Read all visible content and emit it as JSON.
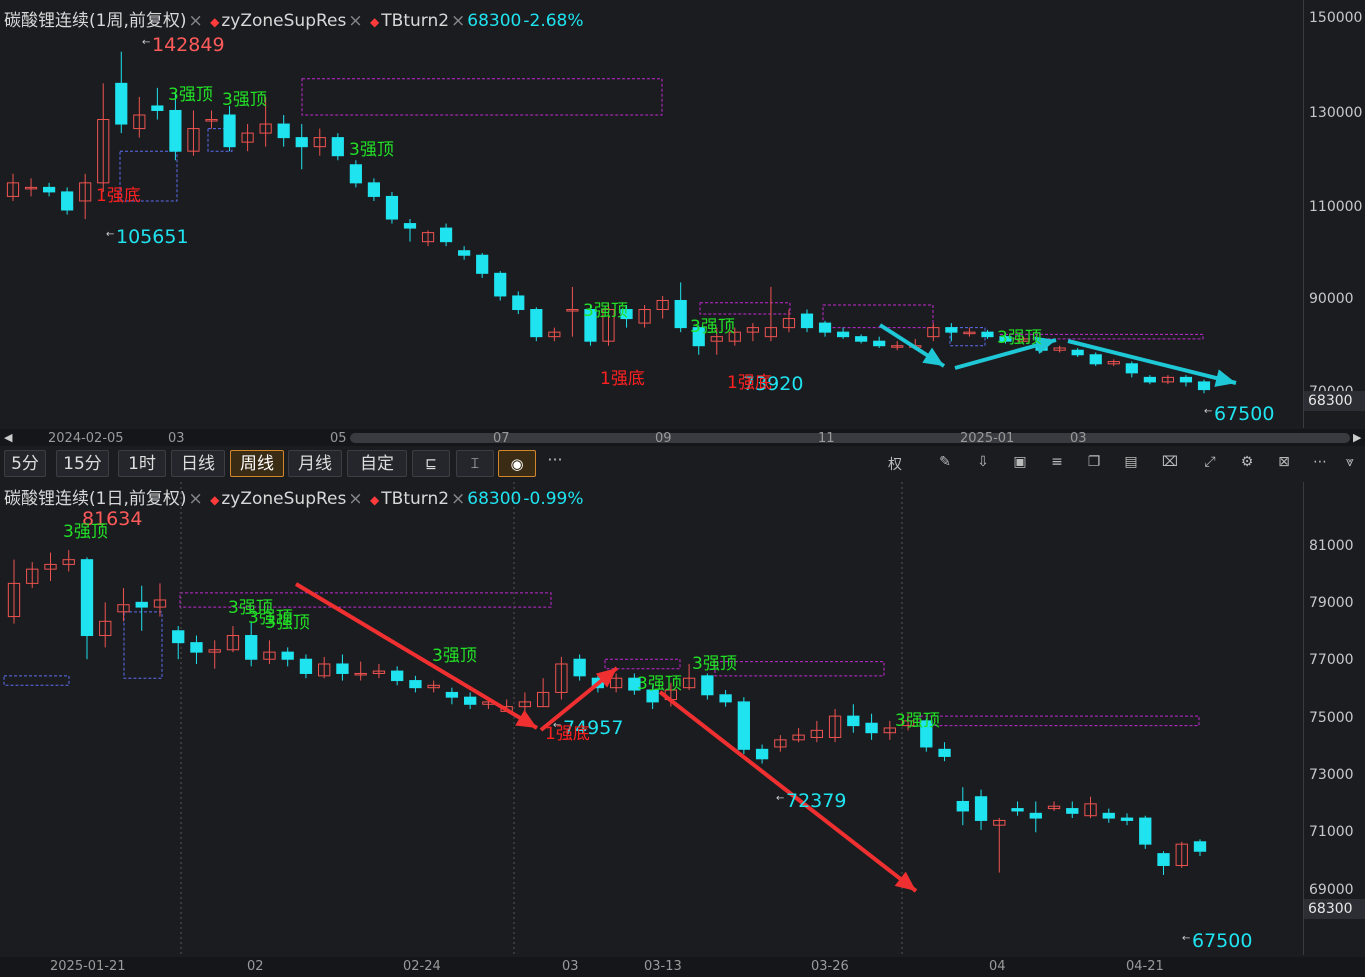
{
  "top": {
    "legend": {
      "title": "碳酸锂连续(1周,前复权)",
      "ind1": "zyZoneSupRes",
      "ind2": "TBturn2",
      "price": "68300",
      "change": "-2.68%"
    },
    "y_ticks": [
      "150000",
      "130000",
      "110000",
      "90000",
      "70000"
    ],
    "current_price": "68300",
    "x_labels": [
      "2024-02-05",
      "03",
      "05",
      "07",
      "09",
      "11",
      "2025-01",
      "03"
    ]
  },
  "toolbar": {
    "timeframes": [
      "5分",
      "15分",
      "1时",
      "日线",
      "周线",
      "月线",
      "自定"
    ],
    "active": "周线",
    "more": "···"
  },
  "bottom": {
    "legend": {
      "title": "碳酸锂连续(1日,前复权)",
      "ind1": "zyZoneSupRes",
      "ind2": "TBturn2",
      "price": "68300",
      "change": "-0.99%"
    },
    "y_ticks": [
      "81000",
      "79000",
      "77000",
      "75000",
      "73000",
      "71000",
      "69000"
    ],
    "current_price": "68300",
    "x_labels": [
      "2025-01-21",
      "02",
      "02-24",
      "03",
      "03-13",
      "03-26",
      "04",
      "04-21"
    ]
  },
  "chart_data": [
    {
      "type": "candlestick",
      "title": "碳酸锂连续(1周,前复权)",
      "ylim": [
        66000,
        150000
      ],
      "candles": [
        [
          111000,
          114000,
          110000,
          116000
        ],
        [
          113000,
          113000,
          111000,
          115000
        ],
        [
          113000,
          112000,
          111000,
          114000
        ],
        [
          112000,
          108000,
          107000,
          113000
        ],
        [
          110000,
          114000,
          106000,
          116000
        ],
        [
          114000,
          128000,
          112000,
          136000
        ],
        [
          136000,
          127000,
          125000,
          143000
        ],
        [
          126000,
          129000,
          124000,
          133000
        ],
        [
          131000,
          130000,
          128000,
          135000
        ],
        [
          130000,
          121000,
          119000,
          134000
        ],
        [
          121000,
          126000,
          120000,
          130000
        ],
        [
          128000,
          128000,
          126000,
          130000
        ],
        [
          129000,
          122000,
          121000,
          131000
        ],
        [
          123000,
          125000,
          121000,
          127000
        ],
        [
          125000,
          127000,
          122000,
          133000
        ],
        [
          127000,
          124000,
          122000,
          129000
        ],
        [
          124000,
          122000,
          117000,
          127000
        ],
        [
          122000,
          124000,
          120000,
          126000
        ],
        [
          124000,
          120000,
          119000,
          125000
        ],
        [
          118000,
          114000,
          113000,
          119000
        ],
        [
          114000,
          111000,
          110000,
          115000
        ],
        [
          111000,
          106000,
          105000,
          112000
        ],
        [
          105000,
          104000,
          101000,
          106000
        ],
        [
          101000,
          103000,
          100000,
          103500
        ],
        [
          104000,
          101000,
          100000,
          105000
        ],
        [
          99000,
          98000,
          97000,
          100000
        ],
        [
          98000,
          94000,
          93000,
          98500
        ],
        [
          94000,
          89000,
          88000,
          94500
        ],
        [
          89000,
          86000,
          85000,
          90000
        ],
        [
          86000,
          80000,
          79000,
          86500
        ],
        [
          80000,
          81000,
          79000,
          82000
        ],
        [
          86000,
          86000,
          80000,
          91000
        ],
        [
          86000,
          79000,
          78000,
          87000
        ],
        [
          79000,
          86000,
          78000,
          87500
        ],
        [
          86000,
          84000,
          82000,
          87000
        ],
        [
          83000,
          86000,
          82000,
          87000
        ],
        [
          86000,
          88000,
          84000,
          89000
        ],
        [
          88000,
          82000,
          81000,
          92000
        ],
        [
          82000,
          78000,
          76000,
          82500
        ],
        [
          79000,
          80000,
          76000,
          82000
        ],
        [
          79000,
          81000,
          78000,
          82000
        ],
        [
          81000,
          82000,
          79000,
          83000
        ],
        [
          80000,
          82000,
          79000,
          91000
        ],
        [
          82000,
          84000,
          81000,
          86000
        ],
        [
          85000,
          82000,
          81000,
          86000
        ],
        [
          83000,
          81000,
          80000,
          83500
        ],
        [
          81000,
          80000,
          79500,
          82000
        ],
        [
          80000,
          79000,
          78500,
          80500
        ],
        [
          79000,
          78000,
          77500,
          80000
        ],
        [
          78000,
          78000,
          77000,
          79000
        ],
        [
          78000,
          78000,
          77500,
          79500
        ],
        [
          80000,
          82000,
          79000,
          83000
        ],
        [
          82000,
          81000,
          79000,
          83000
        ],
        [
          81000,
          81000,
          80000,
          82000
        ],
        [
          81000,
          80000,
          79500,
          81500
        ],
        [
          80000,
          79000,
          78500,
          80500
        ],
        [
          79000,
          79500,
          79000,
          80000
        ],
        [
          78000,
          77000,
          76500,
          78500
        ],
        [
          77000,
          77500,
          76500,
          78000
        ],
        [
          77000,
          76000,
          75500,
          77500
        ],
        [
          76000,
          74000,
          73500,
          76500
        ],
        [
          74000,
          74500,
          73500,
          75000
        ],
        [
          74000,
          72000,
          71000,
          74500
        ],
        [
          71000,
          70000,
          69500,
          71500
        ],
        [
          70000,
          71000,
          69500,
          71500
        ],
        [
          71000,
          70000,
          69000,
          71500
        ],
        [
          70000,
          68300,
          67500,
          70500
        ]
      ],
      "annotations": [
        {
          "text": "142849",
          "kind": "high"
        },
        {
          "text": "105651",
          "kind": "low"
        },
        {
          "text": "73920",
          "kind": "low"
        },
        {
          "text": "67500",
          "kind": "low"
        },
        {
          "text": "3强顶",
          "kind": "signal"
        },
        {
          "text": "1强底",
          "kind": "signal"
        }
      ]
    },
    {
      "type": "candlestick",
      "title": "碳酸锂连续(1日,前复权)",
      "ylim": [
        66000,
        83000
      ],
      "candles": [
        [
          78800,
          80200,
          78500,
          81200
        ],
        [
          80200,
          80800,
          80000,
          81100
        ],
        [
          80800,
          81000,
          80300,
          81500
        ],
        [
          81000,
          81200,
          80700,
          81600
        ],
        [
          81200,
          78000,
          77000,
          81300
        ],
        [
          78000,
          78600,
          77500,
          79400
        ],
        [
          79000,
          79300,
          78600,
          80000
        ],
        [
          79400,
          79200,
          78200,
          80100
        ],
        [
          79200,
          79500,
          78800,
          80200
        ],
        [
          78200,
          77700,
          77000,
          78400
        ],
        [
          77700,
          77300,
          76800,
          78000
        ],
        [
          77300,
          77400,
          76600,
          77800
        ],
        [
          77400,
          78000,
          77300,
          78400
        ],
        [
          78000,
          77000,
          76700,
          78600
        ],
        [
          77000,
          77300,
          76800,
          77800
        ],
        [
          77300,
          77000,
          76700,
          77500
        ],
        [
          77000,
          76400,
          76200,
          77200
        ],
        [
          76300,
          76800,
          76200,
          77100
        ],
        [
          76800,
          76400,
          76100,
          77200
        ],
        [
          76400,
          76400,
          76100,
          76900
        ],
        [
          76400,
          76500,
          76200,
          76800
        ],
        [
          76500,
          76100,
          75900,
          76700
        ],
        [
          76100,
          75800,
          75600,
          76300
        ],
        [
          75800,
          75900,
          75600,
          76100
        ],
        [
          75600,
          75400,
          75100,
          75800
        ],
        [
          75400,
          75100,
          74900,
          75600
        ],
        [
          75100,
          75200,
          74900,
          75400
        ],
        [
          74800,
          75000,
          74900,
          75300
        ],
        [
          75000,
          75200,
          74600,
          75600
        ],
        [
          75000,
          75600,
          75000,
          76200
        ],
        [
          75600,
          76800,
          75300,
          77100
        ],
        [
          77000,
          76300,
          76100,
          77200
        ],
        [
          76200,
          75800,
          75600,
          76300
        ],
        [
          75800,
          76200,
          75600,
          76400
        ],
        [
          76200,
          75700,
          75500,
          76400
        ],
        [
          75700,
          75200,
          74900,
          75900
        ],
        [
          75300,
          75700,
          75000,
          76000
        ],
        [
          75800,
          76200,
          75700,
          76800
        ],
        [
          76300,
          75500,
          75300,
          76400
        ],
        [
          75500,
          75200,
          75000,
          75700
        ],
        [
          75200,
          73200,
          73000,
          75400
        ],
        [
          73200,
          72800,
          72600,
          73400
        ],
        [
          73300,
          73600,
          73100,
          73800
        ],
        [
          73600,
          73800,
          73500,
          74100
        ],
        [
          73700,
          74000,
          73500,
          74400
        ],
        [
          73700,
          74600,
          73500,
          74900
        ],
        [
          74600,
          74200,
          73900,
          75100
        ],
        [
          74300,
          73900,
          73600,
          74700
        ],
        [
          73900,
          74100,
          73600,
          74400
        ],
        [
          74200,
          74400,
          74000,
          74700
        ],
        [
          74400,
          73300,
          73100,
          74500
        ],
        [
          73200,
          72900,
          72700,
          73500
        ],
        [
          71000,
          70600,
          70000,
          71600
        ],
        [
          71200,
          70200,
          69800,
          71500
        ],
        [
          70000,
          70200,
          68000,
          70300
        ],
        [
          70700,
          70600,
          70400,
          71000
        ],
        [
          70500,
          70300,
          69700,
          71000
        ],
        [
          70700,
          70800,
          70600,
          71000
        ],
        [
          70700,
          70500,
          70300,
          71000
        ],
        [
          70400,
          70900,
          70300,
          71200
        ],
        [
          70500,
          70300,
          70100,
          70700
        ],
        [
          70300,
          70200,
          70000,
          70500
        ],
        [
          70300,
          69200,
          69000,
          70400
        ],
        [
          68800,
          68300,
          67900,
          68900
        ],
        [
          68300,
          69200,
          68200,
          69300
        ],
        [
          69300,
          68900,
          68700,
          69400
        ]
      ],
      "annotations": [
        {
          "text": "81634",
          "kind": "high"
        },
        {
          "text": "74957",
          "kind": "low"
        },
        {
          "text": "72379",
          "kind": "low"
        },
        {
          "text": "67500",
          "kind": "low"
        },
        {
          "text": "3强顶",
          "kind": "signal"
        },
        {
          "text": "1强底",
          "kind": "signal"
        }
      ]
    }
  ]
}
